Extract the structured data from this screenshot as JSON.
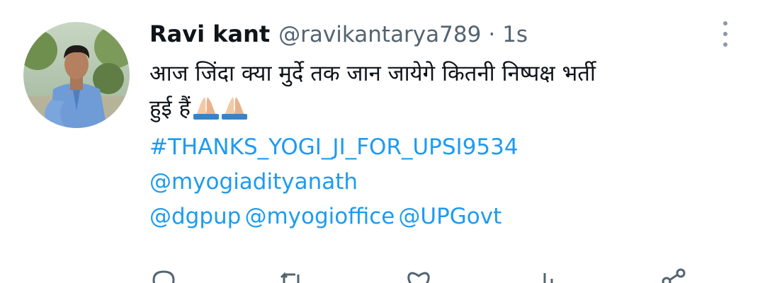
{
  "tweet": {
    "author_name": "Ravi kant",
    "handle": "@ravikantarya789",
    "separator": "·",
    "time": "1s",
    "text_line1": "आज जिंदा क्या मुर्दे तक जान जायेगे कितनी निष्पक्ष भर्ती",
    "text_line2": "हुई हैं",
    "emoji": "🙏🏼🙏🏼",
    "hashtag": "#THANKS_YOGI_JI_FOR_UPSI9534",
    "mention_1": "@myogiadityanath",
    "mention_2": "@dgpup",
    "mention_3": "@myogioffice",
    "mention_4": "@UPGovt"
  },
  "icons": {
    "more": "more-vertical-icon",
    "reply": "reply-icon",
    "retweet": "retweet-icon",
    "like": "like-icon",
    "stats": "analytics-icon",
    "share": "share-icon",
    "emoji": "folded-hands-icon"
  },
  "colors": {
    "link": "#1d9bf0",
    "text": "#0f1419",
    "secondary": "#536471"
  }
}
